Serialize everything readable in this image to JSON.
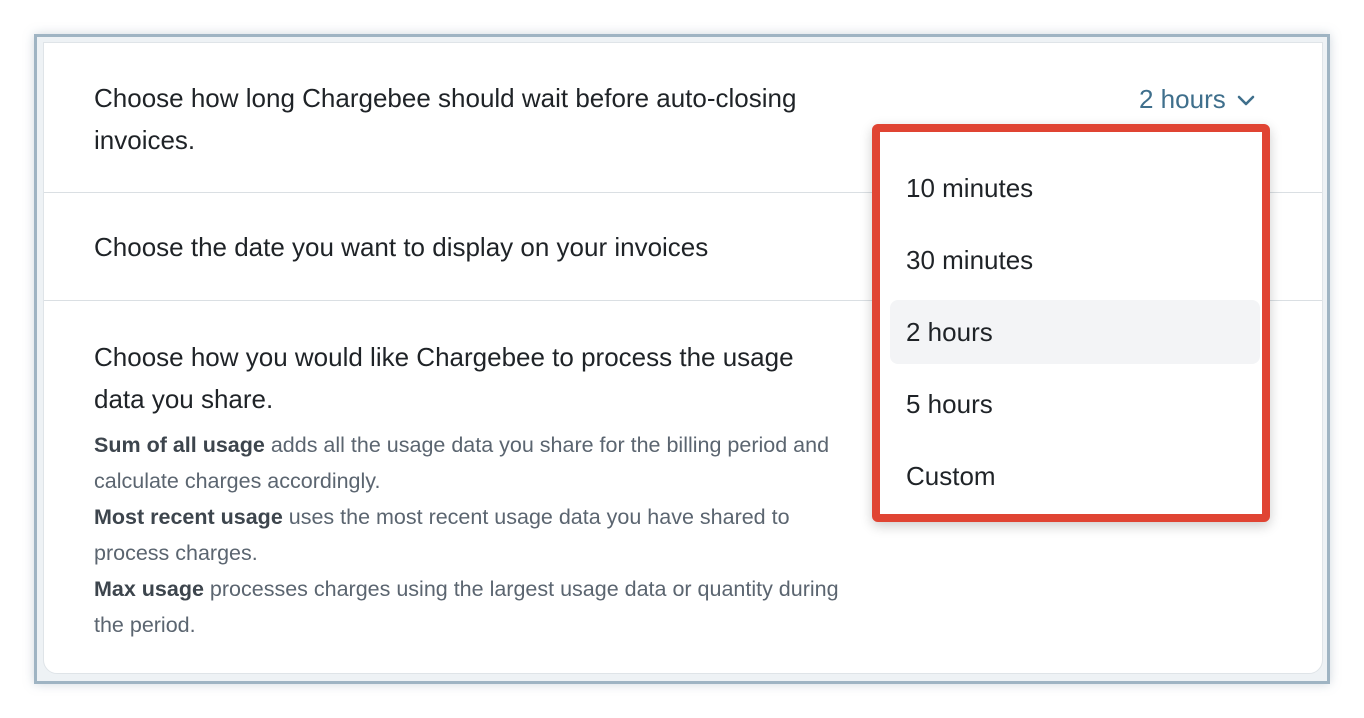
{
  "settings": {
    "rows": [
      {
        "description": "Choose how long Chargebee should wait before auto-closing invoices."
      },
      {
        "description": "Choose the date you want to display on your invoices"
      },
      {
        "description": "Choose how you would like Chargebee to process the usage data you share.",
        "help": [
          {
            "term": "Sum of all usage",
            "text": " adds all the usage data you share for the billing period and calculate charges accordingly."
          },
          {
            "term": "Most recent usage",
            "text": " uses the most recent usage data you have shared to process charges."
          },
          {
            "term": "Max usage",
            "text": " processes charges using the largest usage data or quantity during the period."
          }
        ]
      }
    ]
  },
  "select": {
    "value": "2 hours",
    "icon": "chevron-down-icon",
    "options": [
      "10 minutes",
      "30 minutes",
      "2 hours",
      "5 hours",
      "Custom"
    ],
    "selected_index": 2
  },
  "colors": {
    "accent": "#3f6f8c",
    "highlight_border": "#e04433",
    "selected_bg": "#f3f4f6"
  }
}
